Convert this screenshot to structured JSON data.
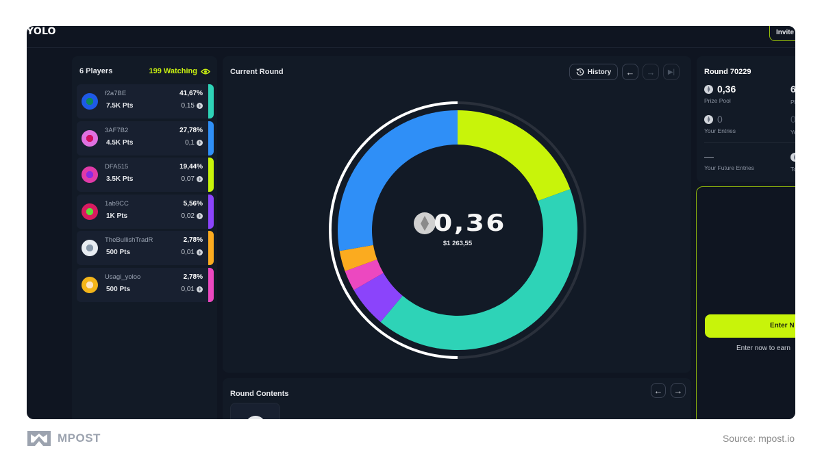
{
  "app": {
    "title": "YOLO",
    "invite_label": "Invite"
  },
  "players_panel": {
    "count_label": "6 Players",
    "watching_label": "199 Watching",
    "players": [
      {
        "name": "f2a7BE",
        "pts": "7.5K Pts",
        "pct": "41,67%",
        "eth": "0,15",
        "color": "#2ed3b7",
        "avatar_colors": [
          "#1e5ae6",
          "#0e8a5a"
        ]
      },
      {
        "name": "3AF7B2",
        "pts": "4.5K Pts",
        "pct": "27,78%",
        "eth": "0,1",
        "color": "#2f8ff7",
        "avatar_colors": [
          "#e070e0",
          "#d01060"
        ]
      },
      {
        "name": "DFA515",
        "pts": "3.5K Pts",
        "pct": "19,44%",
        "eth": "0,07",
        "color": "#c8f40a",
        "avatar_colors": [
          "#e03aa8",
          "#8a2be2"
        ]
      },
      {
        "name": "1ab9CC",
        "pts": "1K Pts",
        "pct": "5,56%",
        "eth": "0,02",
        "color": "#8b44fb",
        "avatar_colors": [
          "#d81b60",
          "#5de03a"
        ]
      },
      {
        "name": "TheBullishTradR",
        "pts": "500 Pts",
        "pct": "2,78%",
        "eth": "0,01",
        "color": "#fbab1f",
        "avatar_colors": [
          "#e8edf2",
          "#8899aa"
        ]
      },
      {
        "name": "Usagi_yoloo",
        "pts": "500 Pts",
        "pct": "2,78%",
        "eth": "0,01",
        "color": "#ec48c0",
        "avatar_colors": [
          "#f4b51a",
          "#fbe4c6"
        ]
      }
    ]
  },
  "current_round": {
    "title": "Current Round",
    "history_label": "History",
    "pot_amount": "0,36",
    "pot_usd": "$1 263,55",
    "timer_progress": 0.5
  },
  "chart_data": {
    "type": "pie",
    "title": "Current Round",
    "center_label": "0,36",
    "center_sublabel": "$1 263,55",
    "order": "clockwise-from-top",
    "slices": [
      {
        "label": "DFA515",
        "value": 19.44,
        "color": "#c8f40a"
      },
      {
        "label": "f2a7BE",
        "value": 41.67,
        "color": "#2ed3b7"
      },
      {
        "label": "1ab9CC",
        "value": 5.56,
        "color": "#8b44fb"
      },
      {
        "label": "Usagi_yoloo",
        "value": 2.78,
        "color": "#ec48c0"
      },
      {
        "label": "TheBullishTradR",
        "value": 2.78,
        "color": "#fbab1f"
      },
      {
        "label": "3AF7B2",
        "value": 27.78,
        "color": "#2f8ff7"
      }
    ]
  },
  "round_contents": {
    "title": "Round Contents"
  },
  "round_info": {
    "title": "Round 70229",
    "prize_pool_value": "0,36",
    "prize_pool_label": "Prize Pool",
    "players_value_partial": "6",
    "players_label_partial": "Pl",
    "your_entries_value": "0",
    "your_entries_label": "Your Entries",
    "right_entries_value_partial": "0",
    "right_entries_label_partial": "Yo",
    "future_entries_value": "—",
    "future_entries_label": "Your Future Entries",
    "total_label_partial": "To"
  },
  "enter_panel": {
    "button_label": "Enter N",
    "note": "Enter now to earn"
  },
  "footer": {
    "brand": "MPOST",
    "source": "Source: mpost.io"
  }
}
